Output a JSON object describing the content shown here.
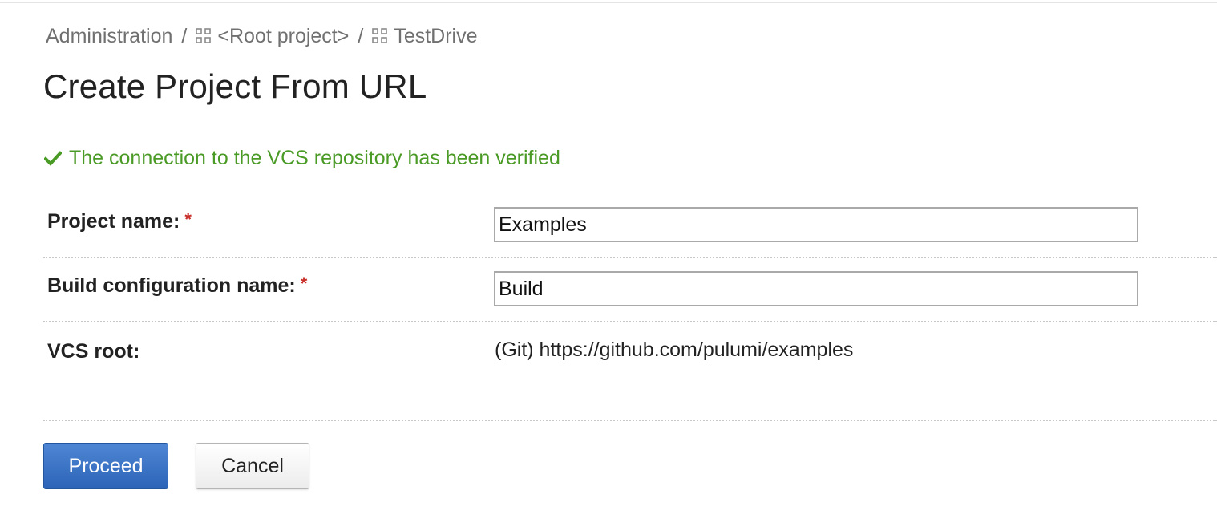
{
  "breadcrumb": {
    "items": [
      {
        "label": "Administration",
        "icon": null
      },
      {
        "label": "<Root project>",
        "icon": "project-grid-icon"
      },
      {
        "label": "TestDrive",
        "icon": "project-grid-icon"
      }
    ],
    "separator": "/"
  },
  "page": {
    "title": "Create Project From URL"
  },
  "status": {
    "message": "The connection to the VCS repository has been verified",
    "icon": "checkmark-icon",
    "color": "#4a9a26"
  },
  "form": {
    "project_name": {
      "label": "Project name:",
      "required_mark": "*",
      "value": "Examples"
    },
    "build_config_name": {
      "label": "Build configuration name:",
      "required_mark": "*",
      "value": "Build"
    },
    "vcs_root": {
      "label": "VCS root:",
      "value": "(Git) https://github.com/pulumi/examples"
    }
  },
  "actions": {
    "proceed_label": "Proceed",
    "cancel_label": "Cancel"
  },
  "colors": {
    "primary_button": "#2c64b8",
    "required": "#c9302c"
  }
}
